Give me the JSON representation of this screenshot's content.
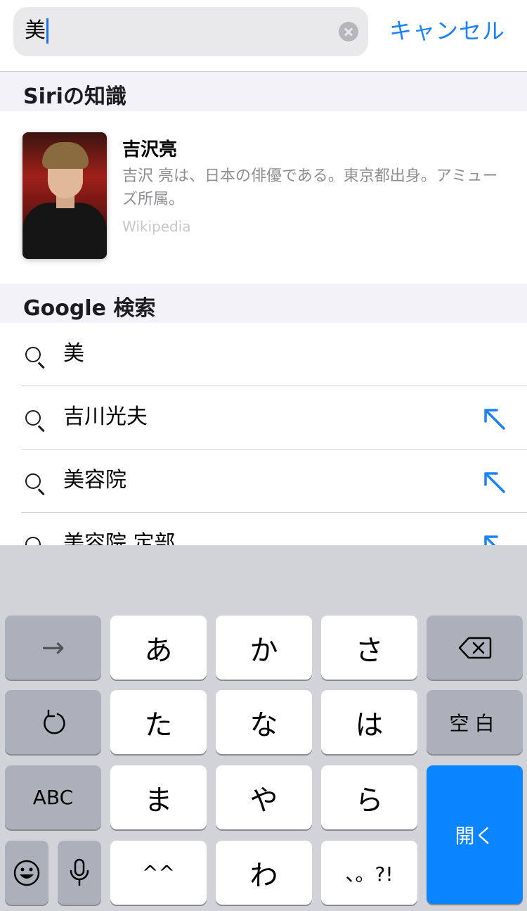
{
  "search": {
    "query": "美",
    "cancel_label": "キャンセル"
  },
  "siri": {
    "section_title": "Siriの知識",
    "card": {
      "title": "吉沢亮",
      "description": "吉沢 亮は、日本の俳優である。東京都出身。アミューズ所属。",
      "source": "Wikipedia"
    }
  },
  "google": {
    "section_title": "Google 検索",
    "suggestions": [
      {
        "text": "美",
        "fill_arrow": false
      },
      {
        "text": "吉川光夫",
        "fill_arrow": true
      },
      {
        "text": "美容院",
        "fill_arrow": true
      },
      {
        "text": "美容院 定部",
        "fill_arrow": true
      }
    ]
  },
  "colors": {
    "accent": "#1a82fb",
    "return_key": "#0a84ff",
    "keyboard_bg": "#d1d3d9"
  },
  "keyboard": {
    "row1": {
      "next": "→",
      "k1": "あ",
      "k2": "か",
      "k3": "さ",
      "delete_icon": "delete-backward-icon"
    },
    "row2": {
      "undo_icon": "undo-icon",
      "k1": "た",
      "k2": "な",
      "k3": "は",
      "space": "空白"
    },
    "row3": {
      "abc": "ABC",
      "k1": "ま",
      "k2": "や",
      "k3": "ら"
    },
    "row4": {
      "emoji_icon": "emoji-icon",
      "mic_icon": "microphone-icon",
      "k1": "^^",
      "k2": "わ",
      "k3": "、。?!"
    },
    "return_label": "開く"
  }
}
